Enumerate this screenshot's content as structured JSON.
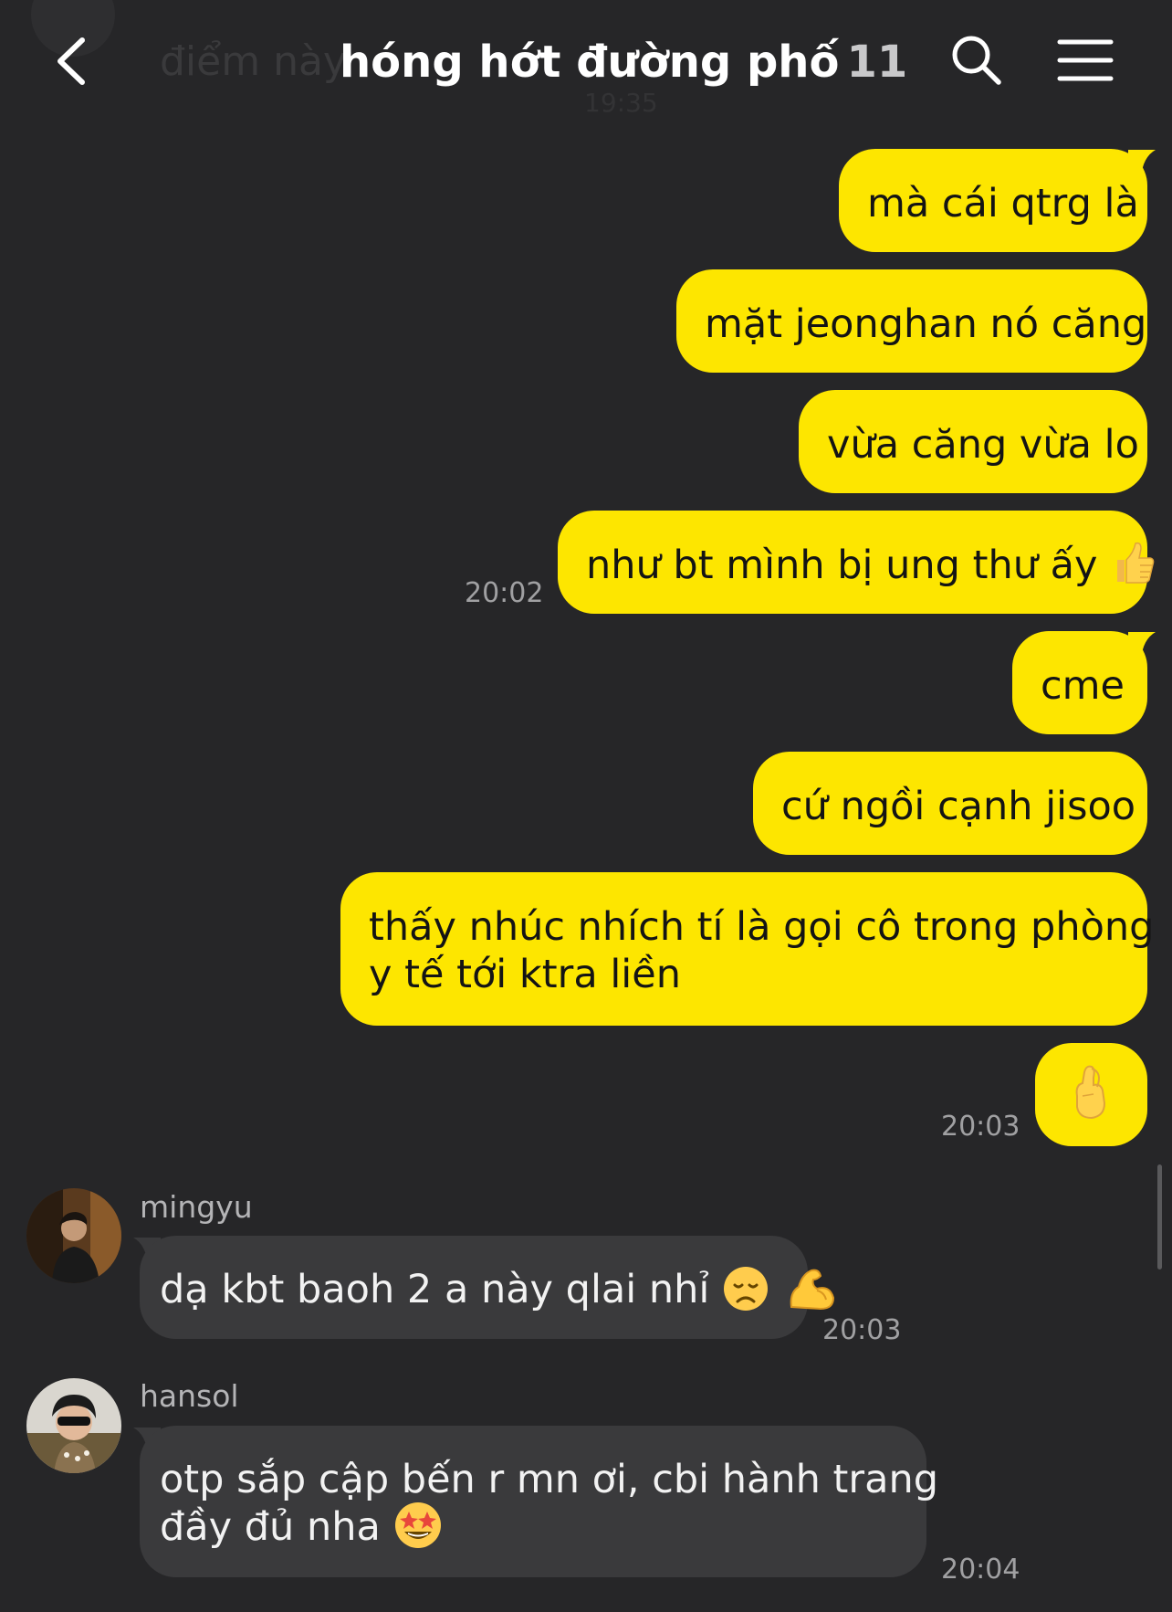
{
  "header": {
    "title": "hóng hớt đường phố",
    "member_count": "11",
    "ghost_preview": "điểm này",
    "ghost_time": "19:35"
  },
  "messages": {
    "m1": "mà cái qtrg là",
    "m2": "mặt jeonghan nó căng",
    "m3": "vừa căng vừa lo",
    "m4": "như bt mình bị ung thư ấy",
    "m4_time": "20:02",
    "m5": "cme",
    "m6": "cứ ngồi cạnh jisoo",
    "m7_line1": "thấy nhúc nhích tí là gọi cô trong phòng",
    "m7_line2": "y tế tới ktra liền",
    "m8_time": "20:03",
    "m9_sender": "mingyu",
    "m9": "dạ kbt baoh 2 a này qlai nhỉ",
    "m9_time": "20:03",
    "m10_sender": "hansol",
    "m10_line1": "otp sắp cập bến r mn ơi, cbi hành trang",
    "m10_line2": "đầy đủ nha",
    "m10_time": "20:04"
  },
  "colors": {
    "background": "#262628",
    "outgoing_bubble": "#fde600",
    "incoming_bubble": "#3a3a3c"
  },
  "icons": {
    "back": "chevron-left-icon",
    "search": "search-icon",
    "menu": "hamburger-menu-icon",
    "thumbs_up": "thumbs-up-emoji",
    "crossed_fingers": "crossed-fingers-emoji",
    "disappointed": "disappointed-face-emoji",
    "flexed_biceps": "flexed-biceps-emoji",
    "star_struck": "star-struck-emoji"
  }
}
